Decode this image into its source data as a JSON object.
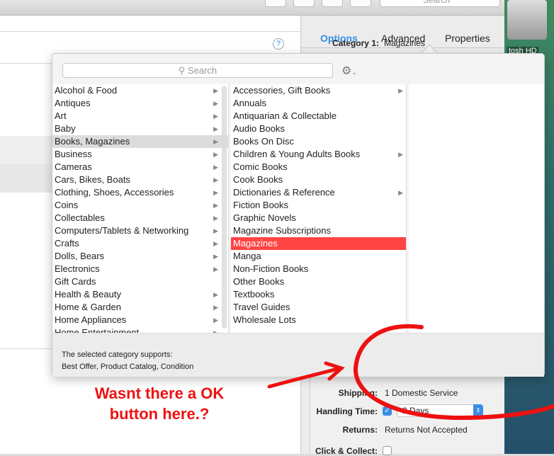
{
  "toolbar": {
    "search_placeholder": "Search"
  },
  "desktop": {
    "drive_label": "tosh HD"
  },
  "right_panel": {
    "tabs": [
      {
        "label": "Options",
        "active": true
      },
      {
        "label": "Advanced"
      },
      {
        "label": "Properties"
      }
    ],
    "category_label": "Category 1:",
    "category_value": "Magazines",
    "shipping_label": "Shipping:",
    "shipping_value": "1 Domestic Service",
    "handling_label": "Handling Time:",
    "handling_checked": true,
    "handling_value": "2 Days",
    "returns_label": "Returns:",
    "returns_value": "Returns Not Accepted",
    "click_collect_label": "Click & Collect:",
    "click_collect_checked": false
  },
  "help_icon": "?",
  "popover": {
    "search_placeholder": "Search",
    "col1": [
      {
        "label": "Alcohol & Food",
        "sub": true
      },
      {
        "label": "Antiques",
        "sub": true
      },
      {
        "label": "Art",
        "sub": true
      },
      {
        "label": "Baby",
        "sub": true
      },
      {
        "label": "Books, Magazines",
        "sub": true,
        "selected": true
      },
      {
        "label": "Business",
        "sub": true
      },
      {
        "label": "Cameras",
        "sub": true
      },
      {
        "label": "Cars, Bikes, Boats",
        "sub": true
      },
      {
        "label": "Clothing, Shoes, Accessories",
        "sub": true
      },
      {
        "label": "Coins",
        "sub": true
      },
      {
        "label": "Collectables",
        "sub": true
      },
      {
        "label": "Computers/Tablets & Networking",
        "sub": true
      },
      {
        "label": "Crafts",
        "sub": true
      },
      {
        "label": "Dolls, Bears",
        "sub": true
      },
      {
        "label": "Electronics",
        "sub": true
      },
      {
        "label": "Gift Cards",
        "sub": false
      },
      {
        "label": "Health & Beauty",
        "sub": true
      },
      {
        "label": "Home & Garden",
        "sub": true
      },
      {
        "label": "Home Appliances",
        "sub": true
      },
      {
        "label": "Home Entertainment",
        "sub": true
      }
    ],
    "col2": [
      {
        "label": "Accessories, Gift Books",
        "sub": true
      },
      {
        "label": "Annuals"
      },
      {
        "label": "Antiquarian & Collectable"
      },
      {
        "label": "Audio Books"
      },
      {
        "label": "Books On Disc"
      },
      {
        "label": "Children & Young Adults Books",
        "sub": true
      },
      {
        "label": "Comic Books"
      },
      {
        "label": "Cook Books"
      },
      {
        "label": "Dictionaries & Reference",
        "sub": true
      },
      {
        "label": "Fiction Books"
      },
      {
        "label": "Graphic Novels"
      },
      {
        "label": "Magazine Subscriptions"
      },
      {
        "label": "Magazines",
        "highlighted": true
      },
      {
        "label": "Manga"
      },
      {
        "label": "Non-Fiction Books"
      },
      {
        "label": "Other Books"
      },
      {
        "label": "Textbooks"
      },
      {
        "label": "Travel Guides"
      },
      {
        "label": "Wholesale Lots"
      }
    ],
    "footer_line1": "The selected category supports:",
    "footer_line2": "Best Offer, Product Catalog, Condition"
  },
  "annotation": {
    "line1": "Wasnt there a OK",
    "line2": "button here.?",
    "color": "#ee1111"
  },
  "colors": {
    "accent": "#3a8ee6",
    "highlight": "#ff4444"
  }
}
